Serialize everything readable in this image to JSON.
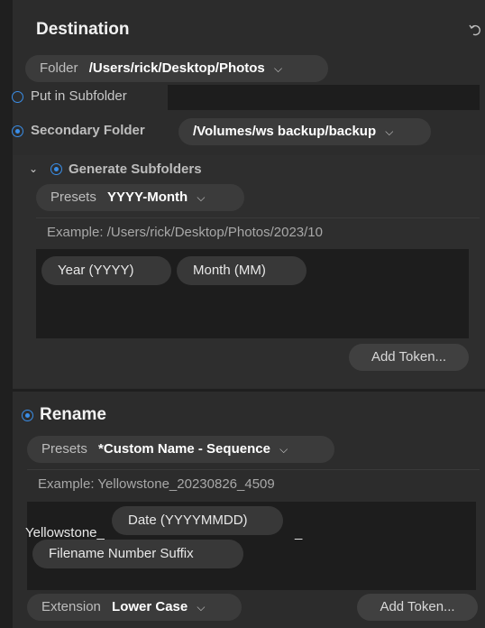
{
  "destination": {
    "title": "Destination",
    "reset_icon": "undo-arrow-icon",
    "folder": {
      "label": "Folder",
      "value": "/Users/rick/Desktop/Photos"
    },
    "put_in_subfolder": {
      "label": "Put in Subfolder",
      "selected": false,
      "value": ""
    },
    "secondary_folder": {
      "label": "Secondary Folder",
      "selected": true,
      "value": "/Volumes/ws backup/backup"
    },
    "generate_subfolders": {
      "label": "Generate Subfolders",
      "selected": true,
      "presets": {
        "label": "Presets",
        "value": "YYYY-Month"
      },
      "example": "Example: /Users/rick/Desktop/Photos/2023/10",
      "tokens": [
        "Year (YYYY)",
        "Month (MM)"
      ],
      "add_token": "Add Token..."
    }
  },
  "rename": {
    "title": "Rename",
    "selected": true,
    "presets": {
      "label": "Presets",
      "value": "*Custom Name - Sequence"
    },
    "example": "Example: Yellowstone_20230826_4509",
    "text_prefix": "Yellowstone_",
    "tokens": [
      "Date (YYYYMMDD)",
      "Filename Number Suffix"
    ],
    "text_separator": "_",
    "extension": {
      "label": "Extension",
      "value": "Lower Case"
    },
    "add_token": "Add Token..."
  },
  "colors": {
    "accent": "#3a8ee8",
    "panel": "#2c2c2c",
    "field": "#1d1d1d"
  }
}
